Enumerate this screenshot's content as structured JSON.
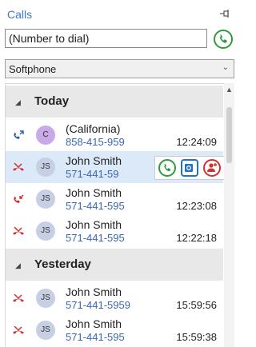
{
  "header": {
    "title": "Calls",
    "pin_icon": "pin-icon"
  },
  "dial": {
    "placeholder": "(Number to dial)",
    "call_icon": "phone-icon",
    "call_color": "#2f9a3d"
  },
  "mode": {
    "selected": "Softphone"
  },
  "groups": [
    {
      "label": "Today"
    },
    {
      "label": "Yesterday"
    }
  ],
  "calls": [
    {
      "direction": "outgoing",
      "initials": "C",
      "avatar_color": "#c9a9e6",
      "name": "(California)",
      "number": "858-415-959",
      "time": "12:24:09"
    },
    {
      "direction": "missed",
      "initials": "JS",
      "avatar_color": "#c7cfe4",
      "name": "John Smith",
      "number": "571-441-59",
      "time": ""
    },
    {
      "direction": "missed-incoming",
      "initials": "JS",
      "avatar_color": "#c7cfe4",
      "name": "John Smith",
      "number": "571-441-595",
      "time": "12:23:08"
    },
    {
      "direction": "missed",
      "initials": "JS",
      "avatar_color": "#c7cfe4",
      "name": "John Smith",
      "number": "571-441-595",
      "time": "12:22:18"
    },
    {
      "direction": "missed",
      "initials": "JS",
      "avatar_color": "#c7cfe4",
      "name": "John Smith",
      "number": "571-441-5959",
      "time": "15:59:56"
    },
    {
      "direction": "missed",
      "initials": "JS",
      "avatar_color": "#c7cfe4",
      "name": "John Smith",
      "number": "571-441-595",
      "time": "15:59:38"
    }
  ],
  "colors": {
    "accent": "#3a7bc8",
    "missed": "#d32f2f",
    "outgoing": "#2a5db0",
    "outlook": "#1e73c8"
  }
}
